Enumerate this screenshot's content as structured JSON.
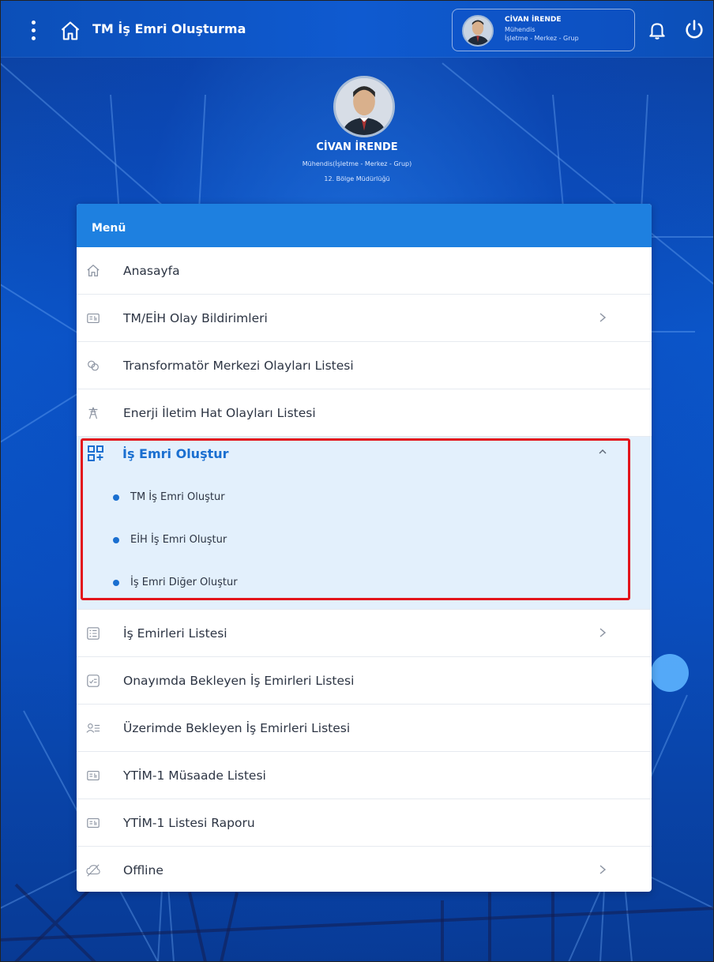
{
  "header": {
    "title": "TM İş Emri Oluşturma",
    "user": {
      "name": "CİVAN İRENDE",
      "role": "Mühendis",
      "dept": "İşletme - Merkez - Grup"
    }
  },
  "hero": {
    "name": "CİVAN İRENDE",
    "role": "Mühendis(İşletme - Merkez - Grup)",
    "region": "12. Bölge Müdürlüğü"
  },
  "menu": {
    "title": "Menü",
    "items": [
      {
        "label": "Anasayfa",
        "icon": "home-icon"
      },
      {
        "label": "TM/EİH Olay Bildirimleri",
        "icon": "report-icon"
      },
      {
        "label": "Transformatör Merkezi Olayları Listesi",
        "icon": "transformer-icon"
      },
      {
        "label": "Enerji İletim Hat Olayları Listesi",
        "icon": "tower-icon"
      }
    ],
    "group": {
      "label": "İş Emri Oluştur",
      "icon": "qr-add-icon",
      "expanded": true,
      "subitems": [
        {
          "label": "TM İş Emri Oluştur"
        },
        {
          "label": "EİH İş Emri Oluştur"
        },
        {
          "label": "İş Emri Diğer Oluştur"
        }
      ]
    },
    "items_after": [
      {
        "label": "İş Emirleri Listesi",
        "icon": "list-icon"
      },
      {
        "label": "Onayımda Bekleyen İş Emirleri Listesi",
        "icon": "approval-icon"
      },
      {
        "label": "Üzerimde Bekleyen İş Emirleri Listesi",
        "icon": "user-list-icon"
      },
      {
        "label": "YTİM-1 Müsaade Listesi",
        "icon": "report-icon"
      },
      {
        "label": "YTİM-1 Listesi Raporu",
        "icon": "report-icon"
      },
      {
        "label": "Offline",
        "icon": "offline-icon"
      }
    ]
  },
  "colors": {
    "accent": "#1a6fd0",
    "menu_header": "#1e80e0",
    "group_bg": "#e3f0fc",
    "highlight": "#e3141b"
  }
}
